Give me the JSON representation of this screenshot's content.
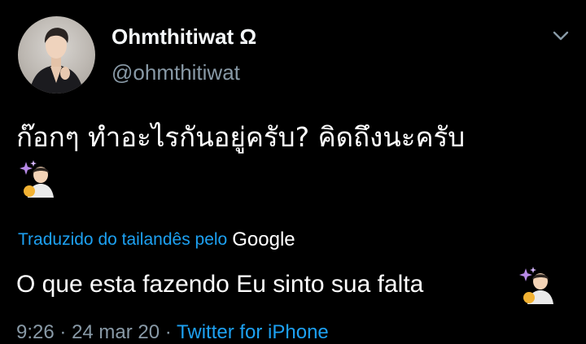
{
  "author": {
    "display_name": "Ohmthitiwat Ω",
    "handle": "@ohmthitiwat"
  },
  "tweet": {
    "text": "ก๊อกๆ ทำอะไรกันอยู่ครับ? คิดถึงนะครับ",
    "emoji_icon": "sparkles-man-emoji-icon"
  },
  "translation": {
    "label": "Traduzido do tailandês pelo",
    "provider": "Google",
    "text": "O que esta fazendo Eu sinto sua falta"
  },
  "meta": {
    "time": "9:26",
    "separator": "·",
    "date": "24 mar 20",
    "source": "Twitter for iPhone"
  },
  "colors": {
    "background": "#000000",
    "link": "#1da1f2",
    "secondary": "#8899a6"
  }
}
